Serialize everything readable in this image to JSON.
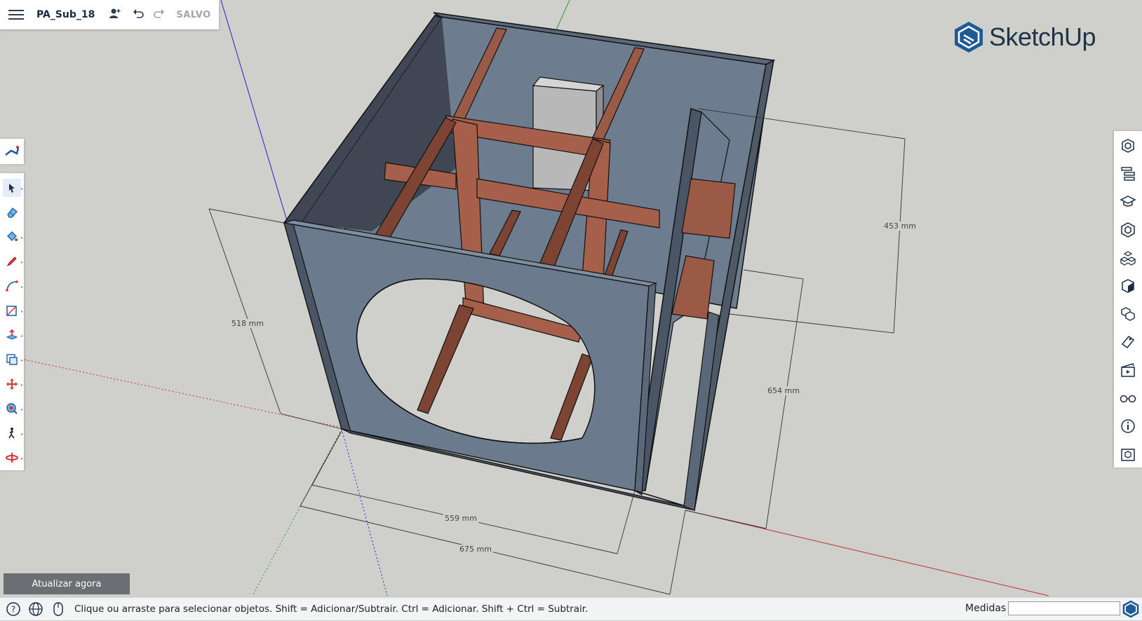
{
  "app": {
    "file_name": "PA_Sub_18",
    "save_status": "SALVO",
    "logo_text": "SketchUp",
    "accent": "#1e5a96"
  },
  "top_bar": {
    "icons": [
      "menu-icon",
      "add-user-icon",
      "undo-icon",
      "redo-icon"
    ]
  },
  "left_toolbar": {
    "tools": [
      {
        "name": "select-tool",
        "icon": "arrow-icon",
        "selected": true
      },
      {
        "name": "eraser-tool",
        "icon": "eraser-icon"
      },
      {
        "name": "paint-bucket-tool",
        "icon": "paint-bucket-icon"
      },
      {
        "name": "pencil-tool",
        "icon": "pencil-icon"
      },
      {
        "name": "arc-tool",
        "icon": "arc-icon"
      },
      {
        "name": "rectangle-tool",
        "icon": "rectangle-icon"
      },
      {
        "name": "push-pull-tool",
        "icon": "push-pull-icon"
      },
      {
        "name": "offset-tool",
        "icon": "offset-icon"
      },
      {
        "name": "move-tool",
        "icon": "move-icon"
      },
      {
        "name": "orbit-tool",
        "icon": "orbit-icon"
      },
      {
        "name": "walk-tool",
        "icon": "walk-icon"
      },
      {
        "name": "section-plane-tool",
        "icon": "section-plane-icon"
      }
    ]
  },
  "right_panel": {
    "icons": [
      "entity-info-icon",
      "outliner-icon",
      "instructor-icon",
      "components-icon",
      "materials-icon",
      "styles-icon",
      "tags-icon",
      "scenes-icon",
      "display-icon",
      "model-info-icon",
      "3d-warehouse-icon"
    ]
  },
  "dimensions": {
    "d1": "453 mm",
    "d2": "518 mm",
    "d3": "654 mm",
    "d4": "559 mm",
    "d5": "675 mm"
  },
  "update_button": "Atualizar agora",
  "status_bar": {
    "message": "Clique ou arraste para selecionar objetos. Shift = Adicionar/Subtrair. Ctrl = Adicionar. Shift + Ctrl = Subtrair.",
    "measurements_label": "Medidas",
    "measurements_value": ""
  },
  "colors": {
    "viewport_bg": "#cfcfcb",
    "panel_face": "#6b7a8c",
    "panel_dark": "#3f4654",
    "brace": "#9a5a46",
    "brace_dark": "#6b3a2c"
  }
}
